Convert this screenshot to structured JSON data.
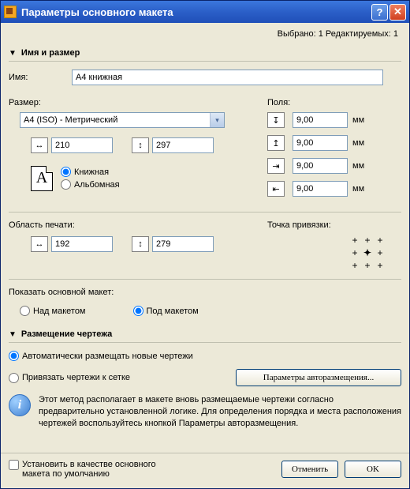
{
  "title": "Параметры основного макета",
  "status": "Выбрано: 1 Редактируемых: 1",
  "section1": {
    "header": "Имя и размер",
    "name_label": "Имя:",
    "name_value": "A4 книжная",
    "size_label": "Размер:",
    "size_select": "A4 (ISO) - Метрический",
    "width": "210",
    "height": "297",
    "orient_portrait": "Книжная",
    "orient_landscape": "Альбомная",
    "margins_label": "Поля:",
    "margin_top": "9,00",
    "margin_bottom": "9,00",
    "margin_left": "9,00",
    "margin_right": "9,00",
    "unit": "мм",
    "print_area_label": "Область печати:",
    "print_w": "192",
    "print_h": "279",
    "anchor_label": "Точка привязки:",
    "show_label": "Показать основной макет:",
    "above": "Над макетом",
    "below": "Под макетом"
  },
  "section2": {
    "header": "Размещение чертежа",
    "auto": "Автоматически размещать новые чертежи",
    "snap": "Привязать чертежи к сетке",
    "params_btn": "Параметры авторазмещения...",
    "info_text": "Этот метод располагает в макете вновь размещаемые чертежи согласно предварительно установленной логике. Для определения порядка и места расположения чертежей воспользуйтесь кнопкой Параметры авторазмещения."
  },
  "bottom": {
    "default_chk": "Установить в качестве основного макета по умолчанию",
    "cancel": "Отменить",
    "ok": "OK"
  }
}
